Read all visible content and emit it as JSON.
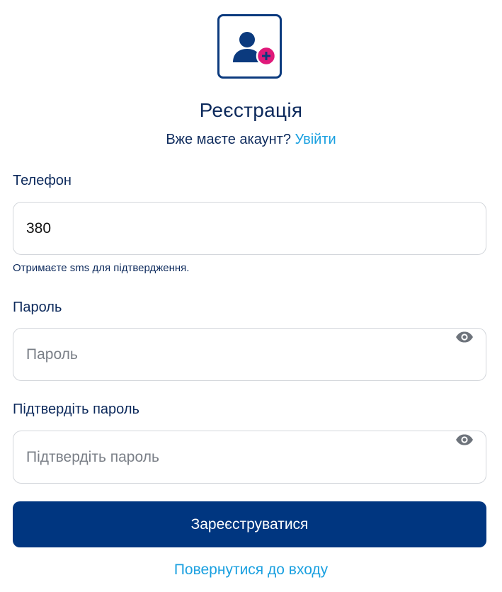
{
  "header": {
    "title": "Реєстрація",
    "have_account_text": "Вже маєте акаунт?",
    "login_link": "Увійти"
  },
  "form": {
    "phone": {
      "label": "Телефон",
      "value": "380",
      "hint": "Отримаєте sms для підтвердження."
    },
    "password": {
      "label": "Пароль",
      "placeholder": "Пароль"
    },
    "confirm_password": {
      "label": "Підтвердіть пароль",
      "placeholder": "Підтвердіть пароль"
    },
    "submit_label": "Зареєструватися",
    "back_link": "Повернутися до входу"
  },
  "icons": {
    "logo": "add-user-icon",
    "password_toggle": "eye-icon"
  },
  "colors": {
    "primary": "#003680",
    "accent_link": "#1aa0e0",
    "logo_plus": "#e0197a",
    "text": "#0d2a5c"
  }
}
